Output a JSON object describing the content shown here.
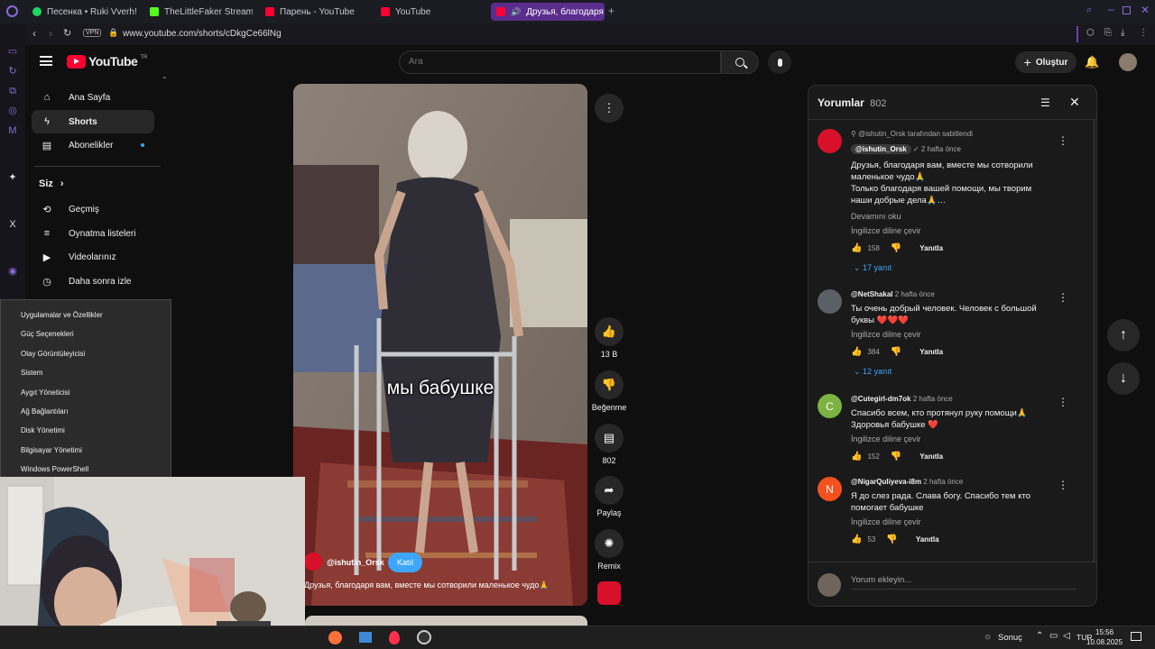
{
  "browser": {
    "tabs": [
      {
        "label": "Песенка • Ruki Vverh!",
        "color": "#1ed760"
      },
      {
        "label": "TheLittleFaker Stream - V",
        "color": "#53fc18"
      },
      {
        "label": "Парень - YouTube",
        "color": "#ff0033"
      },
      {
        "label": "YouTube",
        "color": "#ff0033"
      },
      {
        "label": "Друзья, благодаря в",
        "color": "#ff0033"
      }
    ],
    "vpn_badge": "VPN",
    "url": "www.youtube.com/shorts/cDkgCe66lNg"
  },
  "youtube": {
    "logo_text": "YouTube",
    "logo_region": "TR",
    "search_placeholder": "Ara",
    "create_label": "Oluştur",
    "sidebar": {
      "main": [
        {
          "label": "Ana Sayfa",
          "icon": "home-icon"
        },
        {
          "label": "Shorts",
          "icon": "shorts-icon"
        },
        {
          "label": "Abonelikler",
          "icon": "subscriptions-icon"
        }
      ],
      "you_header": "Siz",
      "you": [
        {
          "label": "Geçmiş",
          "icon": "history-icon"
        },
        {
          "label": "Oynatma listeleri",
          "icon": "playlists-icon"
        },
        {
          "label": "Videolarınız",
          "icon": "your-videos-icon"
        },
        {
          "label": "Daha sonra izle",
          "icon": "watch-later-icon"
        }
      ]
    },
    "short": {
      "caption_overlay": "мы бабушке",
      "channel": "@ishutin_Orsk",
      "join_label": "Katıl",
      "description": "Друзья, благодаря вам, вместе мы сотворили маленькое чудо🙏",
      "likes": "13 B",
      "dislike_label": "Beğenme",
      "comments_count": "802",
      "share_label": "Paylaş",
      "remix_label": "Remix"
    },
    "comments_panel": {
      "title": "Yorumlar",
      "count": "802",
      "add_placeholder": "Yorum ekleyin...",
      "comments": [
        {
          "pinned_note": "@ishutin_Orsk tarafından sabitlendi",
          "author": "@ishutin_Orsk",
          "time": "2 hafta önce",
          "text": "Друзья, благодаря вам, вместе мы сотворили маленькое чудо🙏\nТолько благодаря вашей помощи, мы творим наши добрые дела🙏…",
          "more": "Devamını oku",
          "translate": "İngilizce diline çevir",
          "likes": "158",
          "reply": "Yanıtla",
          "replies": "17 yanıt",
          "avatar_color": "#d8102a",
          "avatar_letter": ""
        },
        {
          "author": "@NetShakal",
          "time": "2 hafta önce",
          "text": "Ты очень добрый человек. Человек с большой буквы ❤️❤️❤️",
          "translate": "İngilizce diline çevir",
          "likes": "384",
          "reply": "Yanıtla",
          "replies": "12 yanıt",
          "avatar_color": "#5b5f66",
          "avatar_letter": ""
        },
        {
          "author": "@Cutegirl-dm7ok",
          "time": "2 hafta önce",
          "text": "Спасибо всем, кто протянул руку помощи🙏\nЗдоровья бабушке ❤️",
          "translate": "İngilizce diline çevir",
          "likes": "152",
          "reply": "Yanıtla",
          "avatar_color": "#7cb342",
          "avatar_letter": "C"
        },
        {
          "author": "@NigarQuliyeva-i8m",
          "time": "2 hafta önce",
          "text": "Я до слез рада. Слава богу. Спасибо тем кто помогает бабушке",
          "translate": "İngilizce diline çevir",
          "likes": "53",
          "reply": "Yanıtla",
          "avatar_color": "#f4511e",
          "avatar_letter": "N"
        }
      ]
    }
  },
  "context_menu": {
    "items": [
      "Uygulamalar ve Özellikler",
      "Güç Seçenekleri",
      "Olay Görüntüleyicisi",
      "Sistem",
      "Aygıt Yöneticisi",
      "Ağ Bağlantıları",
      "Disk Yönetimi",
      "Bilgisayar Yönetimi",
      "Windows PowerShell"
    ]
  },
  "taskbar": {
    "search_label": "Sonuç",
    "lang": "TUR",
    "time": "15:56",
    "date": "10.08.2025"
  },
  "colors": {
    "accent": "#5a2d8c",
    "yt_red": "#ff0033",
    "link_blue": "#3ea6ff",
    "join_blue": "#3ea6ff"
  }
}
